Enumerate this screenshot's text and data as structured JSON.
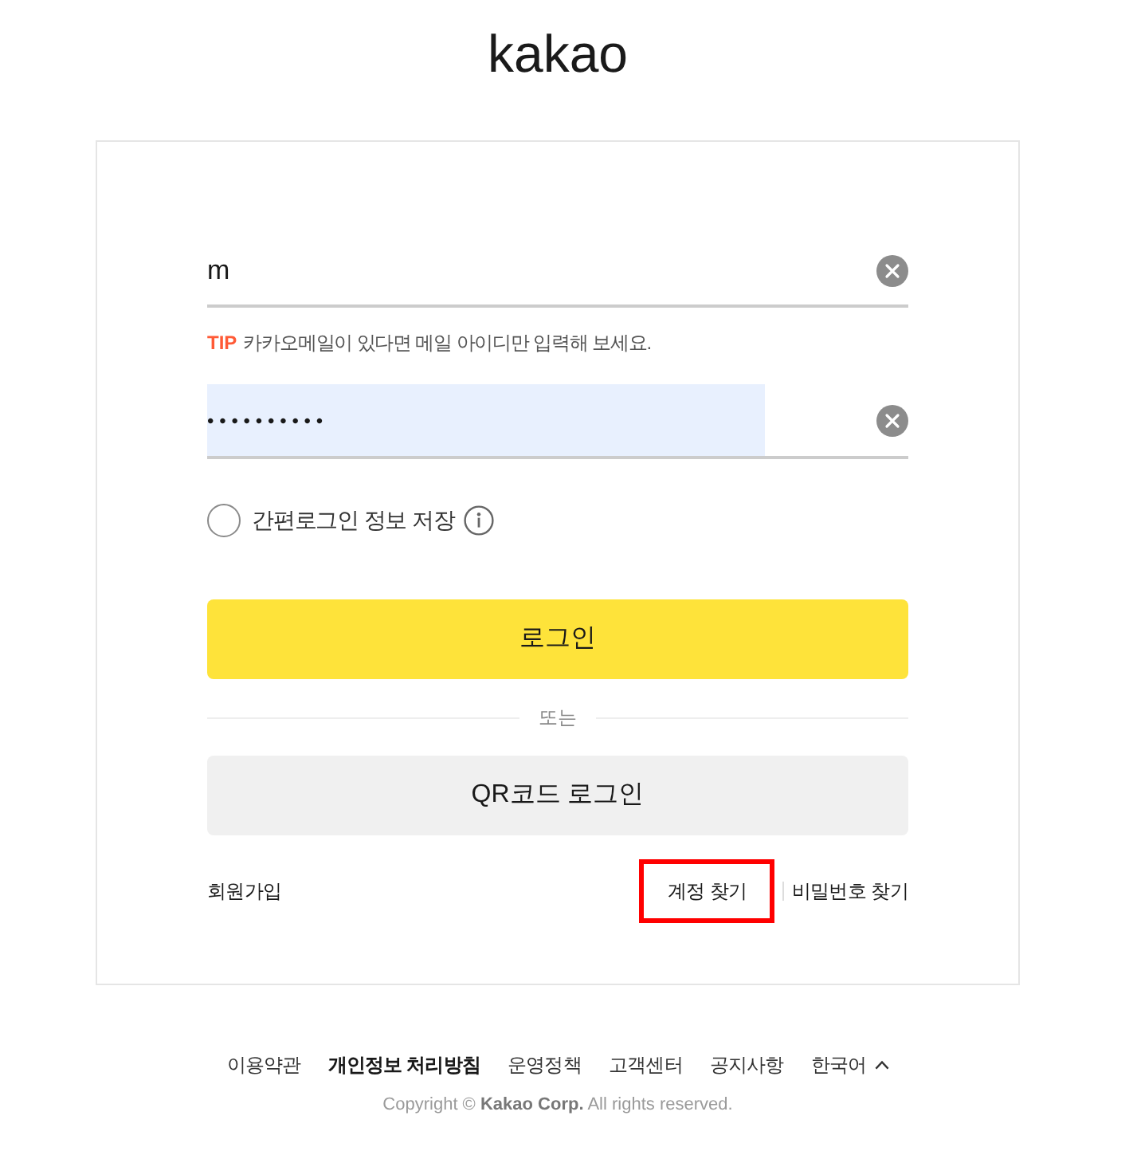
{
  "logo": {
    "text": "kakao"
  },
  "login_form": {
    "id_field": {
      "value": "m",
      "autofilled": false
    },
    "tip": {
      "label": "TIP",
      "text": "카카오메일이 있다면 메일 아이디만 입력해 보세요."
    },
    "password_field": {
      "value": "••••••••••",
      "autofilled": true
    },
    "save_login": {
      "label": "간편로그인 정보 저장",
      "checked": false
    },
    "login_button": "로그인",
    "divider_label": "또는",
    "qr_button": "QR코드 로그인",
    "signup_link": "회원가입",
    "find_links": [
      {
        "label": "계정 찾기",
        "highlighted": true
      },
      {
        "label": "비밀번호 찾기",
        "highlighted": false
      }
    ]
  },
  "footer": {
    "links": [
      {
        "label": "이용약관",
        "emphasized": false
      },
      {
        "label": "개인정보 처리방침",
        "emphasized": true
      },
      {
        "label": "운영정책",
        "emphasized": false
      },
      {
        "label": "고객센터",
        "emphasized": false
      },
      {
        "label": "공지사항",
        "emphasized": false
      }
    ],
    "language": "한국어",
    "copyright": "Copyright © **Kakao Corp.** All rights reserved."
  }
}
